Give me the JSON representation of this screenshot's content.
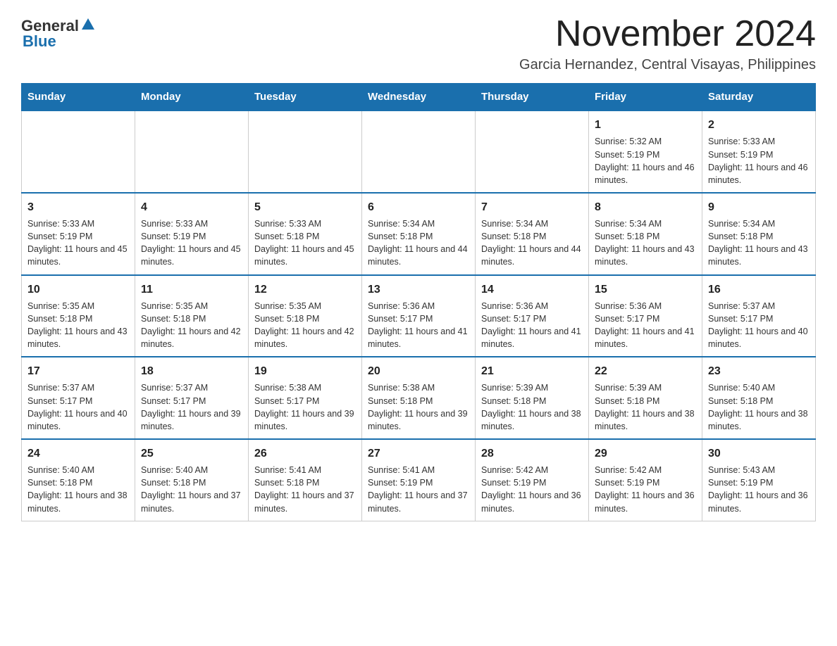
{
  "logo": {
    "general": "General",
    "blue": "Blue"
  },
  "title": "November 2024",
  "subtitle": "Garcia Hernandez, Central Visayas, Philippines",
  "days_of_week": [
    "Sunday",
    "Monday",
    "Tuesday",
    "Wednesday",
    "Thursday",
    "Friday",
    "Saturday"
  ],
  "weeks": [
    [
      {
        "day": "",
        "info": ""
      },
      {
        "day": "",
        "info": ""
      },
      {
        "day": "",
        "info": ""
      },
      {
        "day": "",
        "info": ""
      },
      {
        "day": "",
        "info": ""
      },
      {
        "day": "1",
        "info": "Sunrise: 5:32 AM\nSunset: 5:19 PM\nDaylight: 11 hours and 46 minutes."
      },
      {
        "day": "2",
        "info": "Sunrise: 5:33 AM\nSunset: 5:19 PM\nDaylight: 11 hours and 46 minutes."
      }
    ],
    [
      {
        "day": "3",
        "info": "Sunrise: 5:33 AM\nSunset: 5:19 PM\nDaylight: 11 hours and 45 minutes."
      },
      {
        "day": "4",
        "info": "Sunrise: 5:33 AM\nSunset: 5:19 PM\nDaylight: 11 hours and 45 minutes."
      },
      {
        "day": "5",
        "info": "Sunrise: 5:33 AM\nSunset: 5:18 PM\nDaylight: 11 hours and 45 minutes."
      },
      {
        "day": "6",
        "info": "Sunrise: 5:34 AM\nSunset: 5:18 PM\nDaylight: 11 hours and 44 minutes."
      },
      {
        "day": "7",
        "info": "Sunrise: 5:34 AM\nSunset: 5:18 PM\nDaylight: 11 hours and 44 minutes."
      },
      {
        "day": "8",
        "info": "Sunrise: 5:34 AM\nSunset: 5:18 PM\nDaylight: 11 hours and 43 minutes."
      },
      {
        "day": "9",
        "info": "Sunrise: 5:34 AM\nSunset: 5:18 PM\nDaylight: 11 hours and 43 minutes."
      }
    ],
    [
      {
        "day": "10",
        "info": "Sunrise: 5:35 AM\nSunset: 5:18 PM\nDaylight: 11 hours and 43 minutes."
      },
      {
        "day": "11",
        "info": "Sunrise: 5:35 AM\nSunset: 5:18 PM\nDaylight: 11 hours and 42 minutes."
      },
      {
        "day": "12",
        "info": "Sunrise: 5:35 AM\nSunset: 5:18 PM\nDaylight: 11 hours and 42 minutes."
      },
      {
        "day": "13",
        "info": "Sunrise: 5:36 AM\nSunset: 5:17 PM\nDaylight: 11 hours and 41 minutes."
      },
      {
        "day": "14",
        "info": "Sunrise: 5:36 AM\nSunset: 5:17 PM\nDaylight: 11 hours and 41 minutes."
      },
      {
        "day": "15",
        "info": "Sunrise: 5:36 AM\nSunset: 5:17 PM\nDaylight: 11 hours and 41 minutes."
      },
      {
        "day": "16",
        "info": "Sunrise: 5:37 AM\nSunset: 5:17 PM\nDaylight: 11 hours and 40 minutes."
      }
    ],
    [
      {
        "day": "17",
        "info": "Sunrise: 5:37 AM\nSunset: 5:17 PM\nDaylight: 11 hours and 40 minutes."
      },
      {
        "day": "18",
        "info": "Sunrise: 5:37 AM\nSunset: 5:17 PM\nDaylight: 11 hours and 39 minutes."
      },
      {
        "day": "19",
        "info": "Sunrise: 5:38 AM\nSunset: 5:17 PM\nDaylight: 11 hours and 39 minutes."
      },
      {
        "day": "20",
        "info": "Sunrise: 5:38 AM\nSunset: 5:18 PM\nDaylight: 11 hours and 39 minutes."
      },
      {
        "day": "21",
        "info": "Sunrise: 5:39 AM\nSunset: 5:18 PM\nDaylight: 11 hours and 38 minutes."
      },
      {
        "day": "22",
        "info": "Sunrise: 5:39 AM\nSunset: 5:18 PM\nDaylight: 11 hours and 38 minutes."
      },
      {
        "day": "23",
        "info": "Sunrise: 5:40 AM\nSunset: 5:18 PM\nDaylight: 11 hours and 38 minutes."
      }
    ],
    [
      {
        "day": "24",
        "info": "Sunrise: 5:40 AM\nSunset: 5:18 PM\nDaylight: 11 hours and 38 minutes."
      },
      {
        "day": "25",
        "info": "Sunrise: 5:40 AM\nSunset: 5:18 PM\nDaylight: 11 hours and 37 minutes."
      },
      {
        "day": "26",
        "info": "Sunrise: 5:41 AM\nSunset: 5:18 PM\nDaylight: 11 hours and 37 minutes."
      },
      {
        "day": "27",
        "info": "Sunrise: 5:41 AM\nSunset: 5:19 PM\nDaylight: 11 hours and 37 minutes."
      },
      {
        "day": "28",
        "info": "Sunrise: 5:42 AM\nSunset: 5:19 PM\nDaylight: 11 hours and 36 minutes."
      },
      {
        "day": "29",
        "info": "Sunrise: 5:42 AM\nSunset: 5:19 PM\nDaylight: 11 hours and 36 minutes."
      },
      {
        "day": "30",
        "info": "Sunrise: 5:43 AM\nSunset: 5:19 PM\nDaylight: 11 hours and 36 minutes."
      }
    ]
  ]
}
